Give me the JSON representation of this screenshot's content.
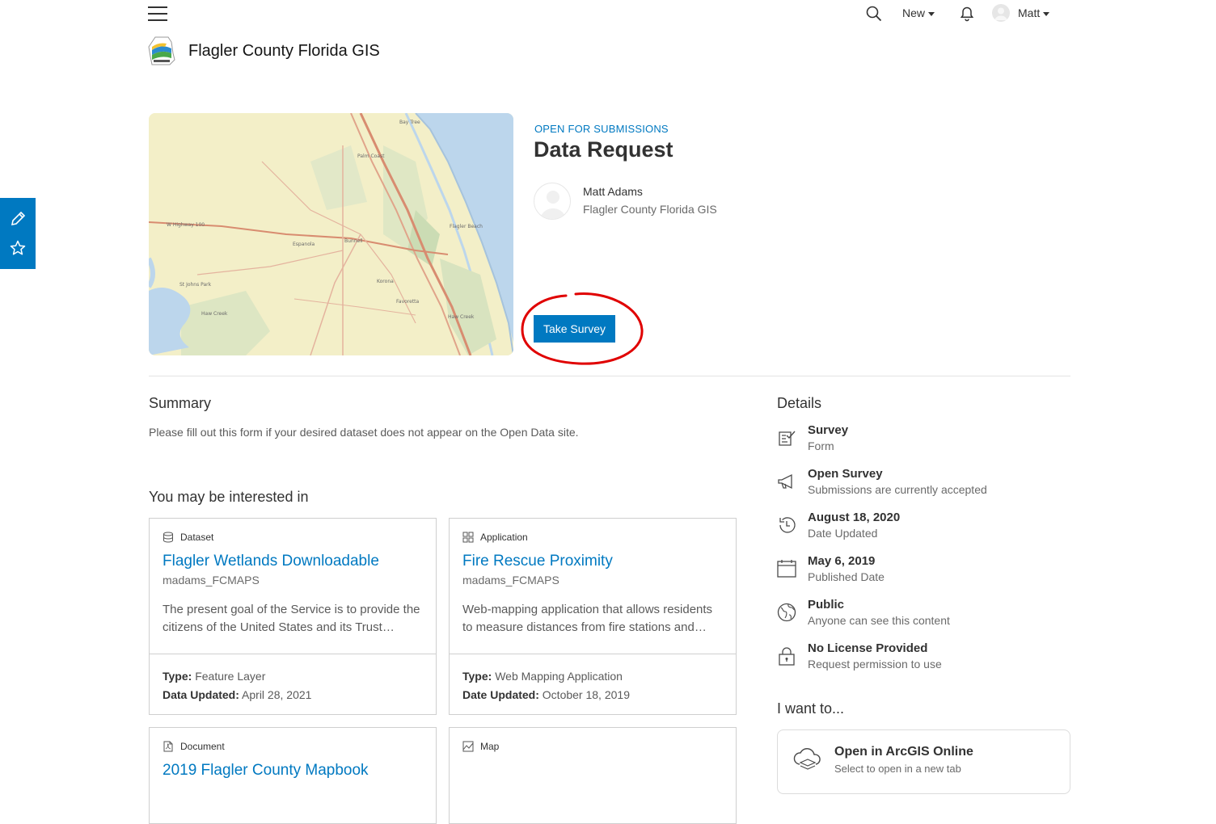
{
  "nav": {
    "new_label": "New",
    "user_name": "Matt"
  },
  "site": {
    "title": "Flagler County Florida GIS"
  },
  "item": {
    "status": "OPEN FOR SUBMISSIONS",
    "title": "Data Request",
    "owner_name": "Matt Adams",
    "owner_org": "Flagler County Florida GIS",
    "primary_action": "Take Survey"
  },
  "map_labels": [
    "Palm Coast",
    "Bunnell",
    "Flagler Beach",
    "Espanola",
    "Korona",
    "Favoretta",
    "St Johns Park",
    "Haw Creek"
  ],
  "summary": {
    "heading": "Summary",
    "text": "Please fill out this form if your desired dataset does not appear on the Open Data site."
  },
  "interest": {
    "heading": "You may be interested in",
    "cards": [
      {
        "type": "Dataset",
        "title": "Flagler Wetlands Downloadable",
        "owner": "madams_FCMAPS",
        "desc": "The present goal of the Service is to provide the citizens of the United States and its Trust Territories with current information on the status and extent of wetlands.",
        "meta1_label": "Type:",
        "meta1_value": "Feature Layer",
        "meta2_label": "Data Updated:",
        "meta2_value": "April 28, 2021"
      },
      {
        "type": "Application",
        "title": "Fire Rescue Proximity",
        "owner": "madams_FCMAPS",
        "desc": "Web-mapping application that allows residents to measure distances from fire stations and hydrants.",
        "meta1_label": "Type:",
        "meta1_value": "Web Mapping Application",
        "meta2_label": "Date Updated:",
        "meta2_value": "October 18, 2019"
      },
      {
        "type": "Document",
        "title": "2019 Flagler County Mapbook"
      },
      {
        "type": "Map",
        "title": ""
      }
    ]
  },
  "details": {
    "heading": "Details",
    "rows": [
      {
        "icon": "survey-icon",
        "title": "Survey",
        "sub": "Form"
      },
      {
        "icon": "megaphone-icon",
        "title": "Open Survey",
        "sub": "Submissions are currently accepted"
      },
      {
        "icon": "history-icon",
        "title": "August 18, 2020",
        "sub": "Date Updated"
      },
      {
        "icon": "calendar-icon",
        "title": "May 6, 2019",
        "sub": "Published Date"
      },
      {
        "icon": "globe-icon",
        "title": "Public",
        "sub": "Anyone can see this content"
      },
      {
        "icon": "lock-icon",
        "title": "No License Provided",
        "sub": "Request permission to use"
      }
    ]
  },
  "iwant": {
    "heading": "I want to...",
    "open_title": "Open in ArcGIS Online",
    "open_sub": "Select to open in a new tab"
  },
  "colors": {
    "brand_blue": "#0079c1",
    "annotation_red": "#e00000"
  }
}
